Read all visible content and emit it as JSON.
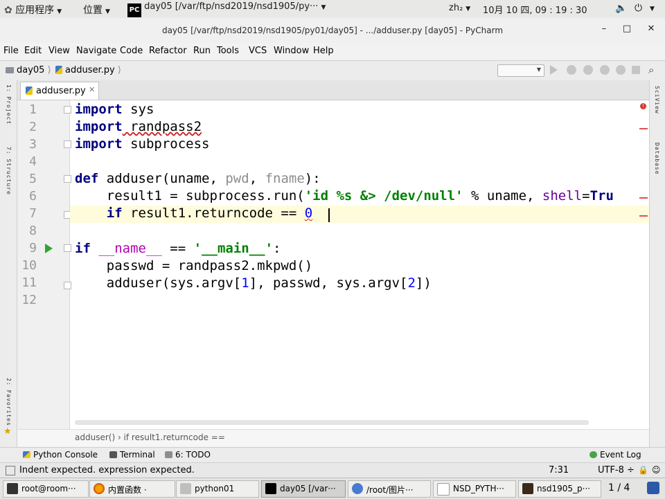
{
  "top_panel": {
    "apps_menu": "应用程序",
    "places_menu": "位置",
    "active_window_label": "day05 [/var/ftp/nsd2019/nsd1905/py···",
    "input_method": "zh₂",
    "datetime": "10月 10 四, 09 : 19 : 30"
  },
  "window": {
    "title": "day05 [/var/ftp/nsd2019/nsd1905/py01/day05] - .../adduser.py [day05] - PyCharm",
    "minimize": "–",
    "maximize": "□",
    "close": "✕"
  },
  "menu": [
    "File",
    "Edit",
    "View",
    "Navigate",
    "Code",
    "Refactor",
    "Run",
    "Tools",
    "VCS",
    "Window",
    "Help"
  ],
  "nav": {
    "project": "day05",
    "file": "adduser.py"
  },
  "left_strip": {
    "top_label": "1: Project",
    "bottom_label": "2: Favorites",
    "middle_label": "7: Structure"
  },
  "right_strip": {
    "top_label": "SciView",
    "second_label": "Database"
  },
  "editor": {
    "tab_label": "adduser.py",
    "lines": [
      {
        "n": "1"
      },
      {
        "n": "2"
      },
      {
        "n": "3"
      },
      {
        "n": "4"
      },
      {
        "n": "5"
      },
      {
        "n": "6"
      },
      {
        "n": "7"
      },
      {
        "n": "8"
      },
      {
        "n": "9"
      },
      {
        "n": "10"
      },
      {
        "n": "11"
      },
      {
        "n": "12"
      }
    ],
    "code": {
      "l1_kw": "import",
      "l1_rest": " sys",
      "l2_kw": "import",
      "l2_rest": " randpass2",
      "l3_kw": "import",
      "l3_rest": " subprocess",
      "l5_kw": "def",
      "l5_name": " adduser(uname, ",
      "l5_p1": "pwd",
      "l5_sep": ", ",
      "l5_p2": "fname",
      "l5_end": "):",
      "l6_a": "    result1 = subprocess.run(",
      "l6_str": "'id %s &> /dev/null'",
      "l6_b": " % uname, ",
      "l6_kw": "shell",
      "l6_c": "=",
      "l6_true": "Tru",
      "l7_kw": "    if",
      "l7_a": " result1.returncode == ",
      "l7_num": "0",
      "l9_kw": "if",
      "l9_a": " ",
      "l9_dunder": "__name__",
      "l9_b": " == ",
      "l9_str": "'__main__'",
      "l9_c": ":",
      "l10": "    passwd = randpass2.mkpwd()",
      "l11_a": "    adduser(sys.argv[",
      "l11_n1": "1",
      "l11_b": "], passwd, sys.argv[",
      "l11_n2": "2",
      "l11_c": "])"
    }
  },
  "breadcrumb": "adduser()  ›  if result1.returncode ==",
  "tool_windows": {
    "python_console": "Python Console",
    "terminal": "Terminal",
    "todo": "6: TODO",
    "event_log": "Event Log"
  },
  "status": {
    "message": "Indent expected. expression expected.",
    "position": "7:31",
    "encoding": "UTF-8",
    "encoding_suffix": "÷"
  },
  "taskbar": {
    "items": [
      {
        "label": "root@room···"
      },
      {
        "label": "内置函数 ·"
      },
      {
        "label": "python01"
      },
      {
        "label": "day05 [/var···"
      },
      {
        "label": "/root/图片···"
      },
      {
        "label": "NSD_PYTH···"
      },
      {
        "label": "nsd1905_p···"
      }
    ],
    "workspace": "1 / 4"
  },
  "colors": {
    "keyword": "#000080",
    "string": "#008000",
    "number": "#0000ff",
    "run_marker": "#2fa52f",
    "error": "#d02020"
  }
}
